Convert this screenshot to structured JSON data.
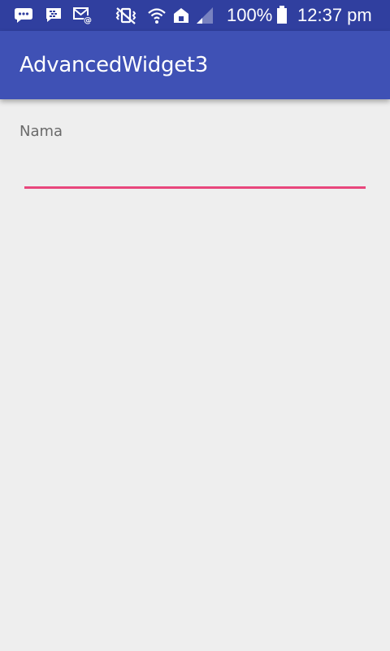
{
  "status_bar": {
    "icons": [
      "chat-bubble-icon",
      "bbm-icon",
      "email-icon",
      "vibrate-icon",
      "wifi-icon",
      "home-network-icon",
      "signal-icon",
      "battery-icon"
    ],
    "battery_percent_text": "100%",
    "time_text": "12:37 pm"
  },
  "app_bar": {
    "title": "AdvancedWidget3"
  },
  "form": {
    "name_label": "Nama",
    "name_value": "",
    "accent_color": "#e8467c"
  },
  "colors": {
    "status_bar": "#303f9f",
    "app_bar": "#3f51b5",
    "background": "#eeeeee"
  }
}
